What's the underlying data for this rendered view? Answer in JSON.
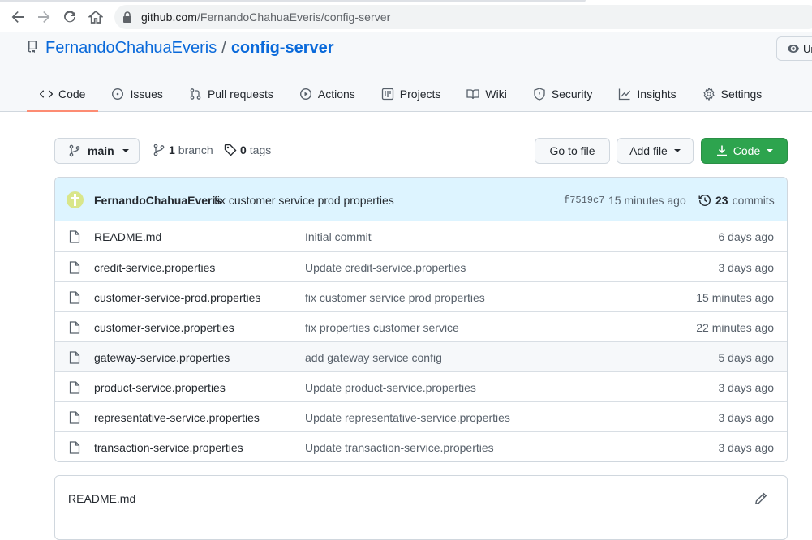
{
  "browser": {
    "url_host": "github.com",
    "url_path": "/FernandoChahuaEveris/config-server"
  },
  "repo": {
    "owner": "FernandoChahuaEveris",
    "separator": "/",
    "name": "config-server",
    "watch_label": "Ur"
  },
  "repo_tabs": [
    {
      "label": "Code",
      "icon": "code-icon",
      "active": true
    },
    {
      "label": "Issues",
      "icon": "issue-icon"
    },
    {
      "label": "Pull requests",
      "icon": "pull-request-icon"
    },
    {
      "label": "Actions",
      "icon": "play-icon"
    },
    {
      "label": "Projects",
      "icon": "project-icon"
    },
    {
      "label": "Wiki",
      "icon": "book-icon"
    },
    {
      "label": "Security",
      "icon": "shield-icon"
    },
    {
      "label": "Insights",
      "icon": "graph-icon"
    },
    {
      "label": "Settings",
      "icon": "gear-icon"
    }
  ],
  "controls": {
    "branch_name": "main",
    "branch_count": "1",
    "branch_label": "branch",
    "tag_count": "0",
    "tag_label": "tags",
    "goto_file": "Go to file",
    "add_file": "Add file",
    "code": "Code"
  },
  "latest_commit": {
    "author": "FernandoChahuaEveris",
    "message": "fix customer service prod properties",
    "sha": "f7519c7",
    "time": "15 minutes ago",
    "commit_count": "23",
    "commit_label": "commits"
  },
  "files": [
    {
      "name": "README.md",
      "commit": "Initial commit",
      "age": "6 days ago"
    },
    {
      "name": "credit-service.properties",
      "commit": "Update credit-service.properties",
      "age": "3 days ago"
    },
    {
      "name": "customer-service-prod.properties",
      "commit": "fix customer service prod properties",
      "age": "15 minutes ago"
    },
    {
      "name": "customer-service.properties",
      "commit": "fix properties customer service",
      "age": "22 minutes ago"
    },
    {
      "name": "gateway-service.properties",
      "commit": "add gateway service config",
      "age": "5 days ago",
      "hover": true
    },
    {
      "name": "product-service.properties",
      "commit": "Update product-service.properties",
      "age": "3 days ago"
    },
    {
      "name": "representative-service.properties",
      "commit": "Update representative-service.properties",
      "age": "3 days ago"
    },
    {
      "name": "transaction-service.properties",
      "commit": "Update transaction-service.properties",
      "age": "3 days ago"
    }
  ],
  "readme": {
    "title": "README.md"
  },
  "colors": {
    "link": "#0969da",
    "green": "#2da44e",
    "active_tab_underline": "#fd8c73",
    "commit_bar": "#ddf4ff"
  }
}
